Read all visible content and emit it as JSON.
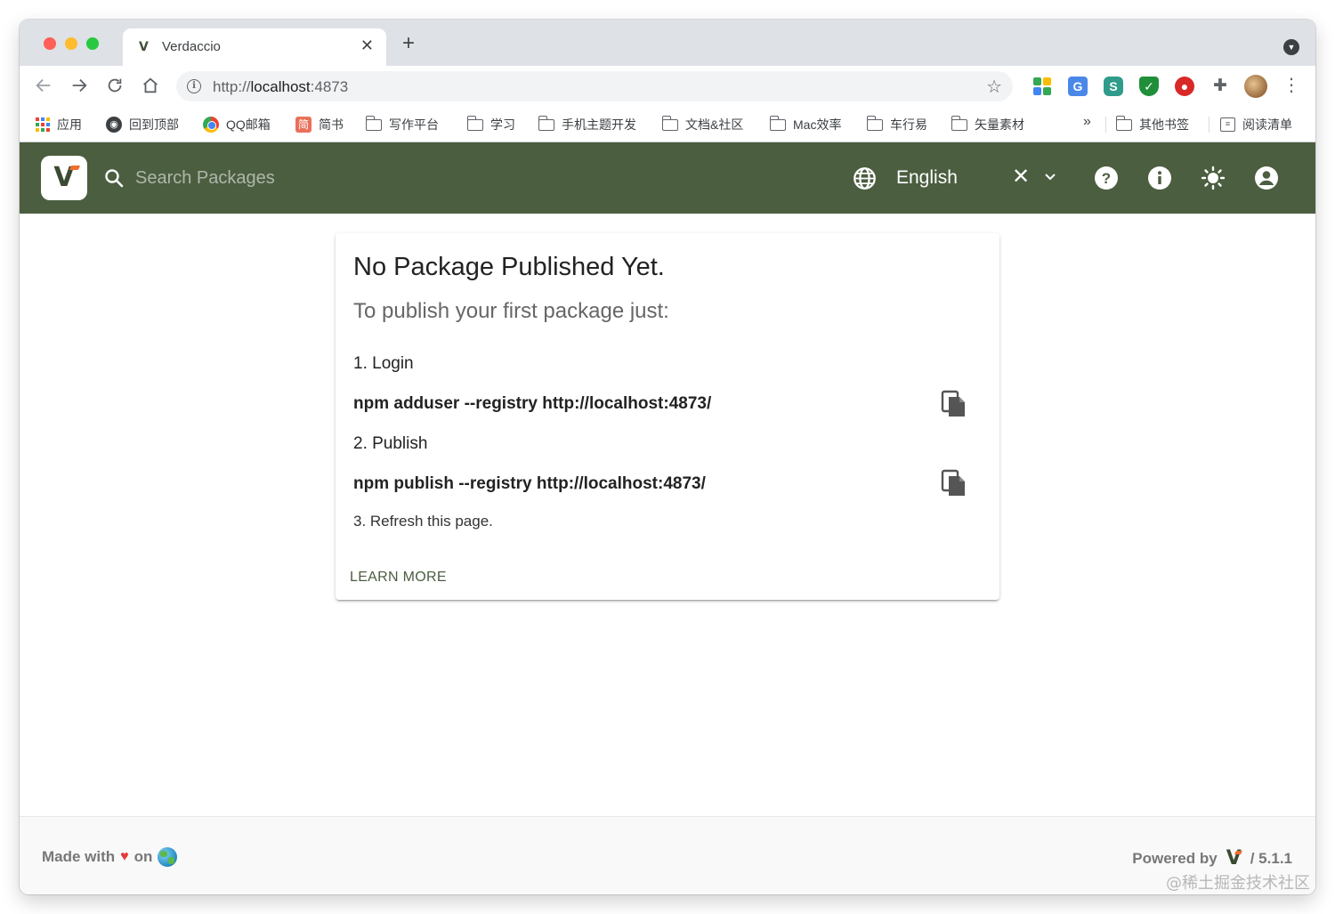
{
  "browser": {
    "tab_title": "Verdaccio",
    "tab_favicon": "V",
    "url": {
      "scheme": "http://",
      "host": "localhost",
      "port": ":4873"
    },
    "icons": [
      "back-icon",
      "forward-icon",
      "reload-icon",
      "home-icon",
      "info-icon",
      "star-icon",
      "extensions-icon",
      "menu-icon"
    ]
  },
  "bookmarks": [
    {
      "label": "应用",
      "icon": "apps-icon"
    },
    {
      "label": "回到顶部",
      "icon": "globe-icon"
    },
    {
      "label": "QQ邮箱",
      "icon": "qq-mail-icon"
    },
    {
      "label": "简书",
      "icon": "jianshu-icon",
      "icon_text": "简"
    },
    {
      "label": "写作平台",
      "icon": "folder-icon"
    },
    {
      "label": "学习",
      "icon": "folder-icon"
    },
    {
      "label": "手机主题开发",
      "icon": "folder-icon"
    },
    {
      "label": "文档&社区",
      "icon": "folder-icon"
    },
    {
      "label": "Mac效率",
      "icon": "folder-icon"
    },
    {
      "label": "车行易",
      "icon": "folder-icon"
    },
    {
      "label": "矢量素材",
      "icon": "folder-icon"
    },
    {
      "label": "其他书签",
      "icon": "folder-icon"
    },
    {
      "label": "阅读清单",
      "icon": "reading-list-icon"
    }
  ],
  "bookmarks_more": "»",
  "appbar": {
    "search_placeholder": "Search Packages",
    "language": "English",
    "clear_symbol": "✕",
    "color": "#4b5e40",
    "accent_color": "#f06e2d"
  },
  "card": {
    "title": "No Package Published Yet.",
    "subtitle": "To publish your first package just:",
    "step1_label": "1. Login",
    "step1_cmd": "npm adduser --registry http://localhost:4873/",
    "step2_label": "2. Publish",
    "step2_cmd": "npm publish --registry http://localhost:4873/",
    "step3_label": "3. Refresh this page.",
    "learn_more": "LEARN MORE"
  },
  "footer": {
    "made_with": "Made with",
    "on": "on",
    "powered_by": "Powered by",
    "version": "/ 5.1.1"
  },
  "watermark": "@稀土掘金技术社区"
}
